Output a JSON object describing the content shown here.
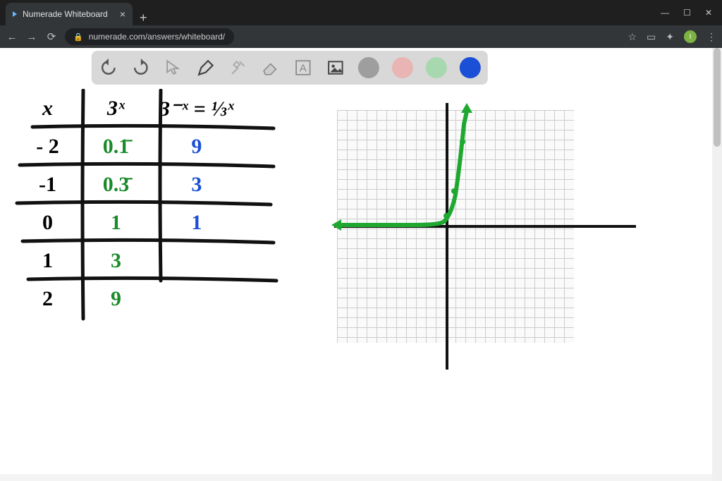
{
  "browser": {
    "tab_title": "Numerade Whiteboard",
    "new_tab_glyph": "+",
    "close_tab_glyph": "×",
    "win_min": "—",
    "win_max": "☐",
    "win_close": "✕",
    "back": "←",
    "forward": "→",
    "reload": "⟳",
    "lock_glyph": "🔒",
    "url": "numerade.com/answers/whiteboard/",
    "star": "☆",
    "display_icon": "▭",
    "ext_icon": "✦",
    "menu": "⋮",
    "profile_initial": "I"
  },
  "toolbar": {
    "tools": [
      "undo",
      "redo",
      "pointer",
      "pen",
      "tools",
      "eraser",
      "text",
      "image"
    ],
    "colors": {
      "gray": "#9e9e9e",
      "pink": "#e8b4b4",
      "green": "#a8d8b0",
      "blue": "#1a4fd6"
    },
    "selected_color": "blue"
  },
  "table": {
    "headers": {
      "c1": "x",
      "c2": "3ˣ",
      "c3": "3⁻ˣ = ⅓ˣ"
    },
    "rows": [
      {
        "x": "- 2",
        "c2": "0.1̄",
        "c3": "9"
      },
      {
        "x": "-1",
        "c2": "0.3̄",
        "c3": "3"
      },
      {
        "x": "0",
        "c2": "1",
        "c3": "1"
      },
      {
        "x": "1",
        "c2": "3",
        "c3": ""
      },
      {
        "x": "2",
        "c2": "9",
        "c3": ""
      }
    ]
  },
  "chart_data": {
    "type": "line",
    "title": "",
    "xlabel": "",
    "ylabel": "",
    "xlim": [
      -12,
      12
    ],
    "ylim": [
      -12,
      12
    ],
    "grid": true,
    "series": [
      {
        "name": "3^x",
        "x": [
          -12,
          -8,
          -4,
          -2,
          -1,
          0,
          1,
          2,
          3
        ],
        "values": [
          0,
          0,
          0.01,
          0.11,
          0.33,
          1,
          3,
          9,
          12
        ],
        "color": "#1ea830"
      }
    ],
    "annotations": [
      "exponential growth curve with left arrow along asymptote y≈0 and up arrow at right end"
    ]
  }
}
